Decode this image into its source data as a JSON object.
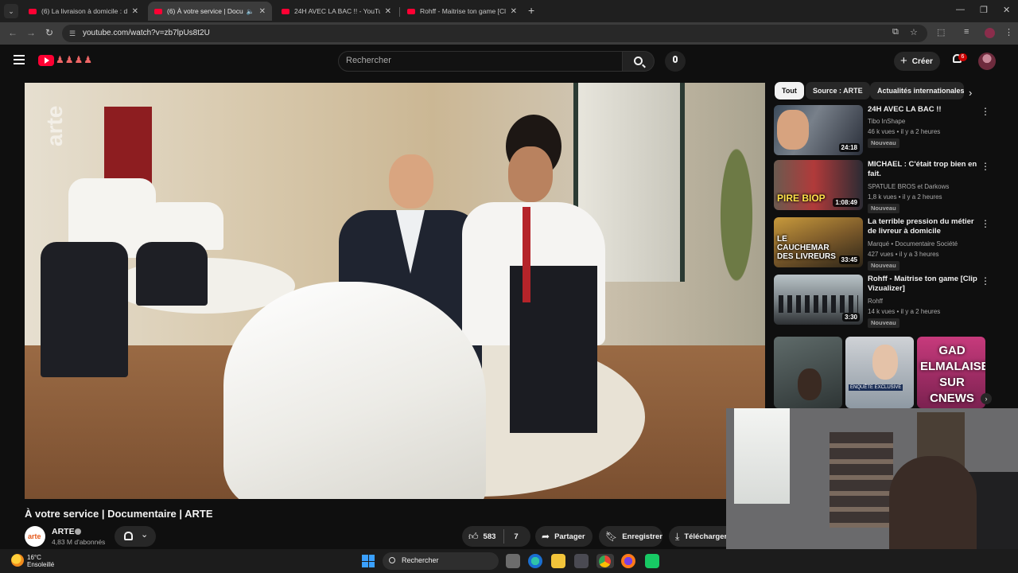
{
  "browser": {
    "tabs": [
      {
        "title": "(6) La livraison à domicile : de l'",
        "active": false
      },
      {
        "title": "(6) À votre service | Docum",
        "active": true,
        "audio": true
      },
      {
        "title": "24H AVEC LA BAC !! - YouTube",
        "active": false
      },
      {
        "title": "Rohff - Maitrise ton game [Clip",
        "active": false
      }
    ],
    "url": "youtube.com/watch?v=zb7lpUs8t2U"
  },
  "youtube": {
    "search_placeholder": "Rechercher",
    "create_label": "Créer",
    "notification_count": "6"
  },
  "video": {
    "title": "À votre service | Documentaire | ARTE",
    "channel": {
      "name": "ARTE",
      "subscribers": "4,83 M d'abonnés",
      "avatar_text": "arte"
    },
    "watermark": "arte",
    "likes": "583",
    "dislikes": "7",
    "share_label": "Partager",
    "save_label": "Enregistrer",
    "download_label": "Télécharger"
  },
  "sidebar": {
    "chips": [
      "Tout",
      "Source : ARTE",
      "Actualités internationales"
    ],
    "recommendations": [
      {
        "title": "24H AVEC LA BAC !!",
        "channel": "Tibo InShape",
        "meta": "46 k vues • il y a 2 heures",
        "duration": "24:18",
        "badge": "Nouveau",
        "thumb_text": ""
      },
      {
        "title": "MICHAEL : C'était trop bien en fait.",
        "channel": "SPATULE BROS et Darkows",
        "meta": "1,8 k vues • il y a 2 heures",
        "duration": "1:08:49",
        "badge": "Nouveau",
        "thumb_text": "PIRE BIOP"
      },
      {
        "title": "La terrible pression du métier de livreur à domicile",
        "channel": "Marqué • Documentaire Société",
        "meta": "427 vues • il y a 3 heures",
        "duration": "33:45",
        "badge": "Nouveau",
        "thumb_text": "LE CAUCHEMAR DES LIVREURS"
      },
      {
        "title": "Rohff - Maitrise ton game [Clip Vizualizer]",
        "channel": "Rohff",
        "meta": "14 k vues • il y a 2 heures",
        "duration": "3:30",
        "badge": "Nouveau",
        "thumb_text": ""
      }
    ],
    "shorts": [
      {
        "text": ""
      },
      {
        "text": "ENQUÊTE EXCLUSIVE"
      },
      {
        "text": "GAD ELMALAISE SUR CNEWS"
      }
    ]
  },
  "taskbar": {
    "weather_temp": "16°C",
    "weather_desc": "Ensoleillé",
    "search_label": "Rechercher"
  },
  "colors": {
    "youtube_red": "#ff0033",
    "background": "#0f0f0f",
    "chip_bg": "#272727"
  }
}
